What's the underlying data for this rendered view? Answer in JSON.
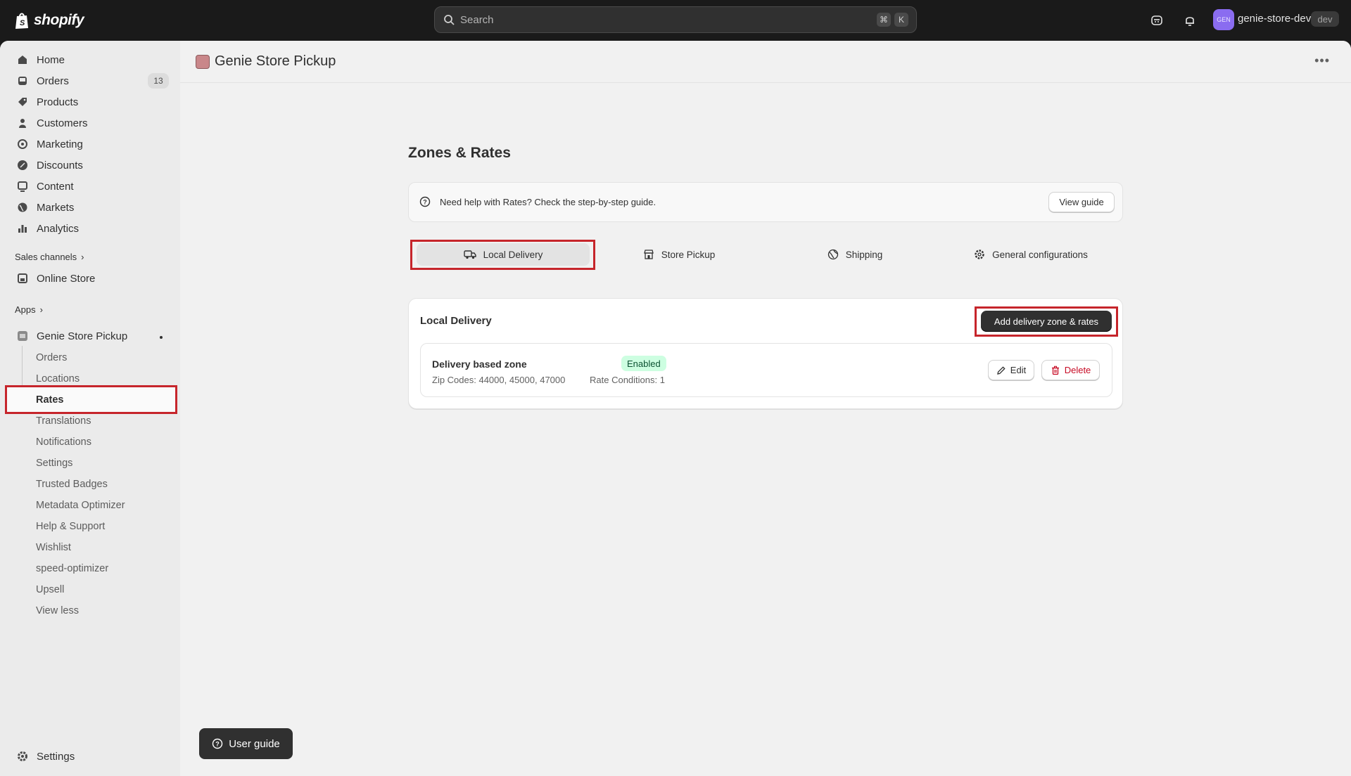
{
  "topbar": {
    "brand": "shopify",
    "search_placeholder": "Search",
    "shortcut_cmd": "⌘",
    "shortcut_key": "K",
    "avatar_initials": "GEN",
    "store_name": "genie-store-dev",
    "store_badge": "dev"
  },
  "sidebar": {
    "items": [
      {
        "label": "Home",
        "icon": "home-icon"
      },
      {
        "label": "Orders",
        "icon": "orders-icon",
        "count": "13"
      },
      {
        "label": "Products",
        "icon": "tag-icon"
      },
      {
        "label": "Customers",
        "icon": "person-icon"
      },
      {
        "label": "Marketing",
        "icon": "target-icon"
      },
      {
        "label": "Discounts",
        "icon": "discount-icon"
      },
      {
        "label": "Content",
        "icon": "content-icon"
      },
      {
        "label": "Markets",
        "icon": "globe-icon"
      },
      {
        "label": "Analytics",
        "icon": "chart-icon"
      }
    ],
    "sales_channels_label": "Sales channels",
    "online_store_label": "Online Store",
    "apps_label": "Apps",
    "app_name": "Genie Store Pickup",
    "app_subitems": [
      "Orders",
      "Locations",
      "Rates",
      "Translations",
      "Notifications",
      "Settings",
      "Trusted Badges",
      "Metadata Optimizer",
      "Help & Support",
      "Wishlist",
      "speed-optimizer",
      "Upsell",
      "View less"
    ],
    "settings_label": "Settings"
  },
  "page": {
    "app_title": "Genie Store Pickup",
    "heading": "Zones & Rates",
    "help_text": "Need help with Rates? Check the step-by-step guide.",
    "view_guide_label": "View guide",
    "tabs": [
      {
        "label": "Local Delivery",
        "icon": "truck-icon"
      },
      {
        "label": "Store Pickup",
        "icon": "store-icon"
      },
      {
        "label": "Shipping",
        "icon": "globe-icon"
      },
      {
        "label": "General configurations",
        "icon": "gear-icon"
      }
    ],
    "card_title": "Local Delivery",
    "add_button_label": "Add delivery zone & rates",
    "zone": {
      "name": "Delivery based zone",
      "status": "Enabled",
      "zip_codes": "Zip Codes: 44000, 45000, 47000",
      "rate_conditions": "Rate Conditions: 1",
      "edit_label": "Edit",
      "delete_label": "Delete"
    },
    "user_guide_label": "User guide"
  },
  "colors": {
    "highlight": "#c6252b",
    "primary_button": "#303030",
    "badge_bg": "#cdfee1",
    "delete": "#c70a24"
  }
}
